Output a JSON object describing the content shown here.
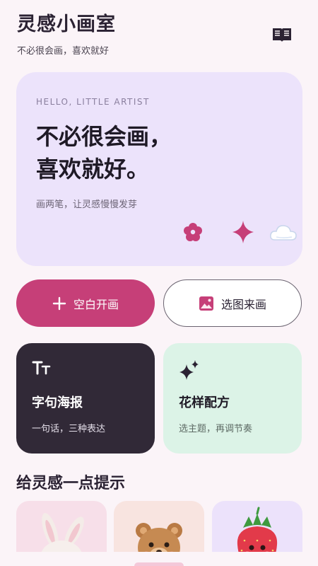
{
  "header": {
    "title": "灵感小画室",
    "subtitle": "不必很会画，喜欢就好",
    "book_icon": "book-open-icon"
  },
  "hero": {
    "eyebrow": "HELLO, LITTLE ARTIST",
    "headline_line1": "不必很会画，",
    "headline_line2": "喜欢就好。",
    "subtitle": "画两笔，让灵感慢慢发芽",
    "icons": [
      "flower-icon",
      "sparkle-icon",
      "cloud-icon"
    ],
    "accent": "#c63f78"
  },
  "actions": {
    "primary_label": "空白开画",
    "primary_icon": "plus-icon",
    "secondary_label": "选图来画",
    "secondary_icon": "image-icon"
  },
  "features": [
    {
      "title": "字句海报",
      "subtitle": "一句话，三种表达",
      "icon": "text-size-icon"
    },
    {
      "title": "花样配方",
      "subtitle": "选主题，再调节奏",
      "icon": "sparkles-icon"
    }
  ],
  "prompts": {
    "section_title": "给灵感一点提示",
    "cards": [
      "bunny-illustration",
      "bear-illustration",
      "strawberry-illustration"
    ]
  },
  "colors": {
    "background": "#fbf4f8",
    "hero_bg": "#ece3fb",
    "primary": "#c63f78",
    "dark_card": "#312937",
    "mint_card": "#dcf3e7"
  }
}
